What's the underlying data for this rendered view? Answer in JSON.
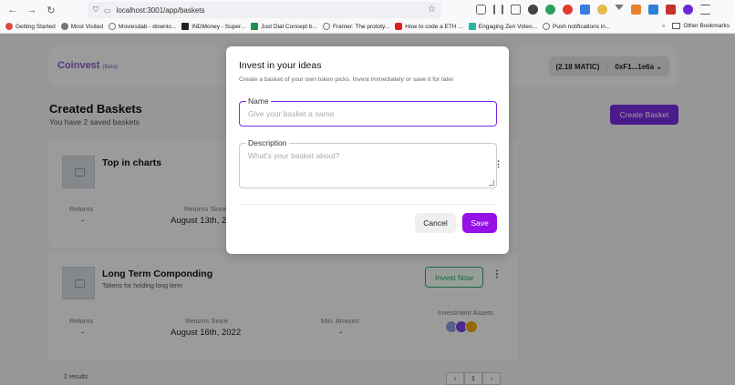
{
  "browser": {
    "url": "localhost:3001/app/baskets",
    "bookmarks": [
      {
        "label": "Getting Started",
        "color": "#e04a3a"
      },
      {
        "label": "Most Visited",
        "color": "#777777"
      },
      {
        "label": "Moviesdab - downlo...",
        "color": "#777777"
      },
      {
        "label": "INDMoney - Super...",
        "color": "#222222"
      },
      {
        "label": "Just Dial Concept b...",
        "color": "#1f8f4f"
      },
      {
        "label": "Framer: The prototy...",
        "color": "#777777"
      },
      {
        "label": "How to code a ETH ...",
        "color": "#e02020"
      },
      {
        "label": "Engaging Zen Video...",
        "color": "#2ab5a5"
      },
      {
        "label": "Push notifications in...",
        "color": "#777777"
      }
    ],
    "other_bookmarks": "Other Bookmarks"
  },
  "header": {
    "brand": "Coinvest",
    "beta": "(Beta)",
    "balance": "(2.18 MATIC)",
    "address": "0xF1...1e6a"
  },
  "main": {
    "title": "Created Baskets",
    "subtitle": "You have 2 saved baskets",
    "create_label": "Create Basket"
  },
  "baskets": [
    {
      "title": "Top in charts",
      "returns_label": "Returns",
      "returns": "-",
      "since_label": "Returns Since",
      "since": "August 13th, 2022"
    },
    {
      "title": "Long Term Componding",
      "description": "Tokens for holding long term",
      "invest_label": "Invest Now",
      "returns_label": "Returns",
      "returns": "-",
      "since_label": "Returns Since",
      "since": "August 16th, 2022",
      "min_label": "Min. Amount",
      "min": "-",
      "assets_label": "Investment Assets"
    }
  ],
  "pager": {
    "count": "2 results"
  },
  "modal": {
    "title": "Invest in your ideas",
    "subtitle": "Create a basket of your own token picks. Invest immediately or save it for later",
    "name_label": "Name",
    "name_placeholder": "Give your basket a name",
    "description_label": "Description",
    "description_placeholder": "What's your basket about?",
    "cancel_label": "Cancel",
    "save_label": "Save"
  },
  "colors": {
    "accent": "#7a2ae0",
    "save": "#9511e6",
    "invest": "#2fa35f"
  }
}
